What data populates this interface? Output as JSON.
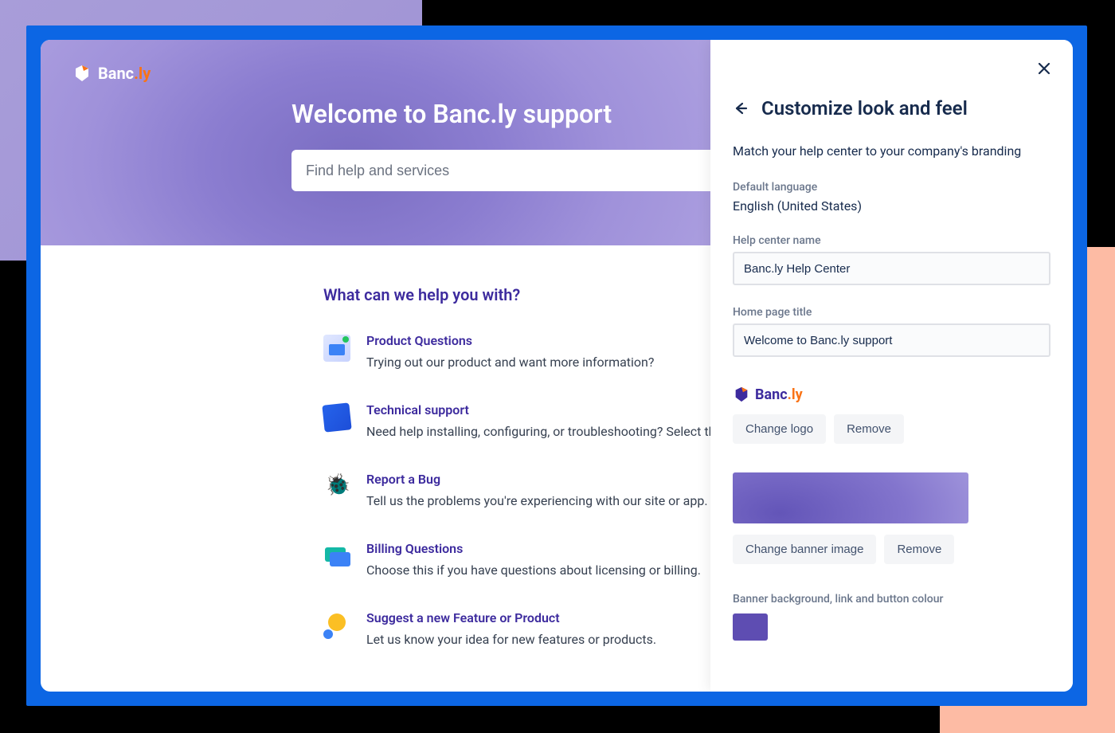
{
  "brand": {
    "name_part1": "Banc",
    "name_part2": ".ly"
  },
  "hero": {
    "title": "Welcome to Banc.ly support",
    "search_placeholder": "Find help and services"
  },
  "content": {
    "heading": "What can we help you with?",
    "topics": [
      {
        "title": "Product Questions",
        "desc": "Trying out our product and want more information?"
      },
      {
        "title": "Technical support",
        "desc": "Need help installing, configuring, or troubleshooting? Select this topic."
      },
      {
        "title": "Report a Bug",
        "desc": "Tell us the problems you're experiencing with our site or app."
      },
      {
        "title": "Billing Questions",
        "desc": "Choose this if you have questions about licensing or billing."
      },
      {
        "title": "Suggest a new Feature or Product",
        "desc": "Let us know your idea for new features or products."
      }
    ]
  },
  "panel": {
    "title": "Customize look and feel",
    "subtitle": "Match your help center to your company's branding",
    "default_language_label": "Default language",
    "default_language_value": "English (United States)",
    "help_center_name_label": "Help center name",
    "help_center_name_value": "Banc.ly Help Center",
    "home_page_title_label": "Home page title",
    "home_page_title_value": "Welcome to Banc.ly support",
    "logo_text_part1": "Banc",
    "logo_text_part2": ".ly",
    "change_logo_btn": "Change logo",
    "remove_logo_btn": "Remove",
    "change_banner_btn": "Change banner image",
    "remove_banner_btn": "Remove",
    "color_label": "Banner background, link and button colour",
    "accent_color": "#5e4db2"
  }
}
